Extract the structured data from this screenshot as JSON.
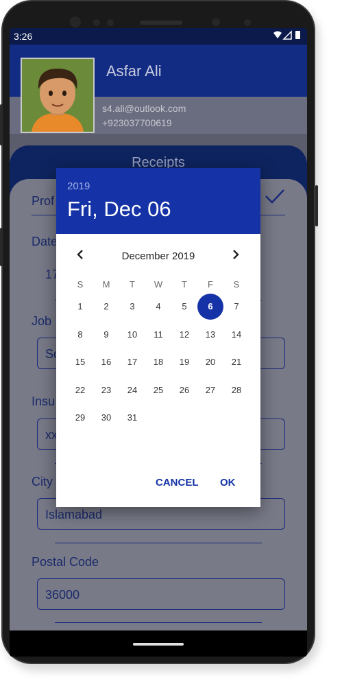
{
  "status_bar": {
    "time": "3:26",
    "icons": "▾◢▮"
  },
  "profile": {
    "name": "Asfar Ali",
    "email": "s4.ali@outlook.com",
    "phone": "+923037700619"
  },
  "card": {
    "title": "Receipts"
  },
  "form": {
    "profile_label_partial": "Prof",
    "date_label_partial": "Date",
    "date_value_partial": "17",
    "job_label_partial": "Job",
    "job_value_partial": "Sc",
    "insurance_label_partial": "Insu",
    "insurance_value_partial": "xx",
    "city_label_partial": "City",
    "city_value": "Islamabad",
    "postal_label": "Postal Code",
    "postal_value": "36000",
    "check_icon": "check-icon"
  },
  "date_picker": {
    "year": "2019",
    "selected_date": "Fri, Dec 06",
    "month_label": "December 2019",
    "prev_icon": "chevron-left-icon",
    "next_icon": "chevron-right-icon",
    "weekdays": [
      "S",
      "M",
      "T",
      "W",
      "T",
      "F",
      "S"
    ],
    "days": [
      "1",
      "2",
      "3",
      "4",
      "5",
      "6",
      "7",
      "8",
      "9",
      "10",
      "11",
      "12",
      "13",
      "14",
      "15",
      "16",
      "17",
      "18",
      "19",
      "20",
      "21",
      "22",
      "23",
      "24",
      "25",
      "26",
      "27",
      "28",
      "29",
      "30",
      "31"
    ],
    "first_weekday_index": 0,
    "selected_day": "6",
    "cancel_label": "CANCEL",
    "ok_label": "OK"
  }
}
